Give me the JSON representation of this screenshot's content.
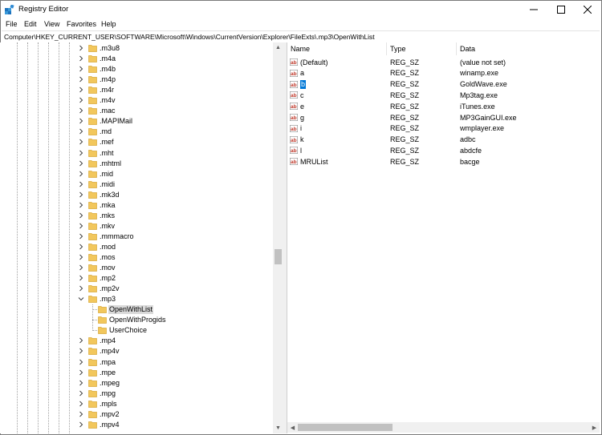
{
  "window": {
    "title": "Registry Editor"
  },
  "menu": [
    "File",
    "Edit",
    "View",
    "Favorites",
    "Help"
  ],
  "address": "Computer\\HKEY_CURRENT_USER\\SOFTWARE\\Microsoft\\Windows\\CurrentVersion\\Explorer\\FileExts\\.mp3\\OpenWithList",
  "tree": {
    "items": [
      {
        "label": ".m3u8",
        "level": 0,
        "expanded": false
      },
      {
        "label": ".m4a",
        "level": 0,
        "expanded": false
      },
      {
        "label": ".m4b",
        "level": 0,
        "expanded": false
      },
      {
        "label": ".m4p",
        "level": 0,
        "expanded": false
      },
      {
        "label": ".m4r",
        "level": 0,
        "expanded": false
      },
      {
        "label": ".m4v",
        "level": 0,
        "expanded": false
      },
      {
        "label": ".mac",
        "level": 0,
        "expanded": false
      },
      {
        "label": ".MAPIMail",
        "level": 0,
        "expanded": false
      },
      {
        "label": ".md",
        "level": 0,
        "expanded": false
      },
      {
        "label": ".mef",
        "level": 0,
        "expanded": false
      },
      {
        "label": ".mht",
        "level": 0,
        "expanded": false
      },
      {
        "label": ".mhtml",
        "level": 0,
        "expanded": false
      },
      {
        "label": ".mid",
        "level": 0,
        "expanded": false
      },
      {
        "label": ".midi",
        "level": 0,
        "expanded": false
      },
      {
        "label": ".mk3d",
        "level": 0,
        "expanded": false
      },
      {
        "label": ".mka",
        "level": 0,
        "expanded": false
      },
      {
        "label": ".mks",
        "level": 0,
        "expanded": false
      },
      {
        "label": ".mkv",
        "level": 0,
        "expanded": false
      },
      {
        "label": ".mmmacro",
        "level": 0,
        "expanded": false
      },
      {
        "label": ".mod",
        "level": 0,
        "expanded": false
      },
      {
        "label": ".mos",
        "level": 0,
        "expanded": false
      },
      {
        "label": ".mov",
        "level": 0,
        "expanded": false
      },
      {
        "label": ".mp2",
        "level": 0,
        "expanded": false
      },
      {
        "label": ".mp2v",
        "level": 0,
        "expanded": false
      },
      {
        "label": ".mp3",
        "level": 0,
        "expanded": true
      },
      {
        "label": "OpenWithList",
        "level": 1,
        "selected": true
      },
      {
        "label": "OpenWithProgids",
        "level": 1
      },
      {
        "label": "UserChoice",
        "level": 1
      },
      {
        "label": ".mp4",
        "level": 0,
        "expanded": false
      },
      {
        "label": ".mp4v",
        "level": 0,
        "expanded": false
      },
      {
        "label": ".mpa",
        "level": 0,
        "expanded": false
      },
      {
        "label": ".mpe",
        "level": 0,
        "expanded": false
      },
      {
        "label": ".mpeg",
        "level": 0,
        "expanded": false
      },
      {
        "label": ".mpg",
        "level": 0,
        "expanded": false
      },
      {
        "label": ".mpls",
        "level": 0,
        "expanded": false
      },
      {
        "label": ".mpv2",
        "level": 0,
        "expanded": false
      },
      {
        "label": ".mpv4",
        "level": 0,
        "expanded": false
      }
    ]
  },
  "list": {
    "columns": [
      "Name",
      "Type",
      "Data"
    ],
    "rows": [
      {
        "name": "(Default)",
        "type": "REG_SZ",
        "data": "(value not set)"
      },
      {
        "name": "a",
        "type": "REG_SZ",
        "data": "winamp.exe"
      },
      {
        "name": "b",
        "type": "REG_SZ",
        "data": "GoldWave.exe",
        "selected": true
      },
      {
        "name": "c",
        "type": "REG_SZ",
        "data": "Mp3tag.exe"
      },
      {
        "name": "e",
        "type": "REG_SZ",
        "data": "iTunes.exe"
      },
      {
        "name": "g",
        "type": "REG_SZ",
        "data": "MP3GainGUI.exe"
      },
      {
        "name": "i",
        "type": "REG_SZ",
        "data": "wmplayer.exe"
      },
      {
        "name": "k",
        "type": "REG_SZ",
        "data": "adbc"
      },
      {
        "name": "l",
        "type": "REG_SZ",
        "data": "abdcfe"
      },
      {
        "name": "MRUList",
        "type": "REG_SZ",
        "data": "bacge"
      }
    ]
  },
  "colors": {
    "folder": "#f2c75c",
    "selection": "#0078d7",
    "tree_selection": "#d9d9d9",
    "string_icon_red": "#c0392b"
  },
  "icons": {
    "app": "registry-cubes-icon",
    "folder": "folder-icon",
    "string_value": "reg-sz-ab-icon",
    "expand": "chevron-right-icon",
    "collapse": "chevron-down-icon"
  }
}
